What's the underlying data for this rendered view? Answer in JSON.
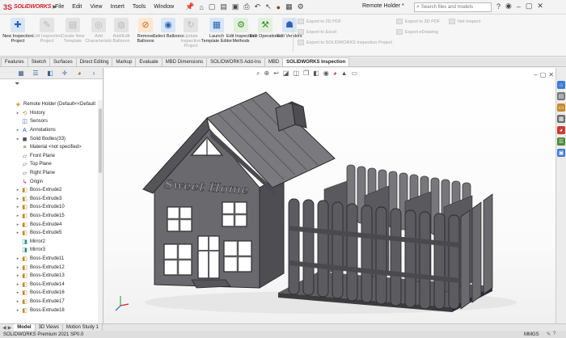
{
  "app": {
    "logo_ds": "3S",
    "logo_text": "SOLIDWORKS",
    "menu": [
      "File",
      "Edit",
      "View",
      "Insert",
      "Tools",
      "Window"
    ],
    "document_title": "Remote Holder *",
    "search_placeholder": "Search files and models"
  },
  "ribbon": {
    "buttons": [
      {
        "label": "New Inspection Project",
        "icon": "new-project-icon",
        "enabled": true
      },
      {
        "label": "Edit Inspection Project",
        "icon": "edit-project-icon",
        "enabled": false
      },
      {
        "label": "Create New Template",
        "icon": "template-icon",
        "enabled": false
      },
      {
        "label": "Add Characteristic",
        "icon": "characteristic-icon",
        "enabled": false
      },
      {
        "label": "Add/Edit Balloons",
        "icon": "balloon-icon",
        "enabled": false
      },
      {
        "label": "Remove Balloons",
        "icon": "remove-balloon-icon",
        "enabled": true
      },
      {
        "label": "Select Balloons",
        "icon": "select-balloon-icon",
        "enabled": true
      },
      {
        "label": "Update Inspection Project",
        "icon": "update-icon",
        "enabled": false
      },
      {
        "label": "Launch Template Editor",
        "icon": "launch-editor-icon",
        "enabled": true
      },
      {
        "label": "Edit Inspection Methods",
        "icon": "methods-icon",
        "enabled": true
      },
      {
        "label": "Edit Operations",
        "icon": "operations-icon",
        "enabled": true
      },
      {
        "label": "Edit Vendors",
        "icon": "vendors-icon",
        "enabled": true
      }
    ],
    "export_left": [
      "Export to 2D PDF",
      "Export to Excel",
      "Export to SOLIDWORKS Inspection Project"
    ],
    "export_right": [
      "Export to 3D PDF",
      "Export eDrawing"
    ],
    "extra": "Net-Inspect"
  },
  "command_tabs": [
    "Features",
    "Sketch",
    "Surfaces",
    "Direct Editing",
    "Markup",
    "Evaluate",
    "MBD Dimensions",
    "SOLIDWORKS Add-Ins",
    "MBD",
    "SOLIDWORKS Inspection"
  ],
  "active_command_tab": "SOLIDWORKS Inspection",
  "feature_tree": {
    "root": "Remote Holder  (Default<<Default",
    "items": [
      {
        "label": "History",
        "icon": "history-icon",
        "expandable": true
      },
      {
        "label": "Sensors",
        "icon": "sensor-icon",
        "expandable": false
      },
      {
        "label": "Annotations",
        "icon": "annotations-icon",
        "expandable": true
      },
      {
        "label": "Solid Bodies(33)",
        "icon": "solid-bodies-icon",
        "expandable": true
      },
      {
        "label": "Material <not specified>",
        "icon": "material-icon",
        "expandable": false
      },
      {
        "label": "Front Plane",
        "icon": "plane-icon",
        "expandable": false
      },
      {
        "label": "Top Plane",
        "icon": "plane-icon",
        "expandable": false
      },
      {
        "label": "Right Plane",
        "icon": "plane-icon",
        "expandable": false
      },
      {
        "label": "Origin",
        "icon": "origin-icon",
        "expandable": false
      },
      {
        "label": "Boss-Extrude2",
        "icon": "extrude-icon",
        "expandable": true
      },
      {
        "label": "Boss-Extrude3",
        "icon": "extrude-icon",
        "expandable": true
      },
      {
        "label": "Boss-Extrude10",
        "icon": "extrude-icon",
        "expandable": true
      },
      {
        "label": "Boss-Extrude15",
        "icon": "extrude-icon",
        "expandable": true
      },
      {
        "label": "Boss-Extrude4",
        "icon": "extrude-icon",
        "expandable": true
      },
      {
        "label": "Boss-Extrude5",
        "icon": "extrude-icon",
        "expandable": true
      },
      {
        "label": "Mirror2",
        "icon": "mirror-icon",
        "expandable": false
      },
      {
        "label": "Mirror3",
        "icon": "mirror-icon",
        "expandable": false
      },
      {
        "label": "Boss-Extrude11",
        "icon": "extrude-icon",
        "expandable": true
      },
      {
        "label": "Boss-Extrude12",
        "icon": "extrude-icon",
        "expandable": true
      },
      {
        "label": "Boss-Extrude13",
        "icon": "extrude-icon",
        "expandable": true
      },
      {
        "label": "Boss-Extrude14",
        "icon": "extrude-icon",
        "expandable": true
      },
      {
        "label": "Boss-Extrude16",
        "icon": "extrude-icon",
        "expandable": true
      },
      {
        "label": "Boss-Extrude17",
        "icon": "extrude-icon",
        "expandable": true
      },
      {
        "label": "Boss-Extrude18",
        "icon": "extrude-icon",
        "expandable": true
      }
    ]
  },
  "model": {
    "engraving": "Sweet Home"
  },
  "bottom_tabs": [
    "Model",
    "3D Views",
    "Motion Study 1"
  ],
  "active_bottom_tab": "Model",
  "status": {
    "text": "SOLIDWORKS Premium 2021 SP0.0",
    "units": "MMGS"
  },
  "colors": {
    "brand": "#d6202a",
    "model_face": "#6e6e72",
    "model_dark": "#3c3c40",
    "accent": "#2a63b8"
  }
}
